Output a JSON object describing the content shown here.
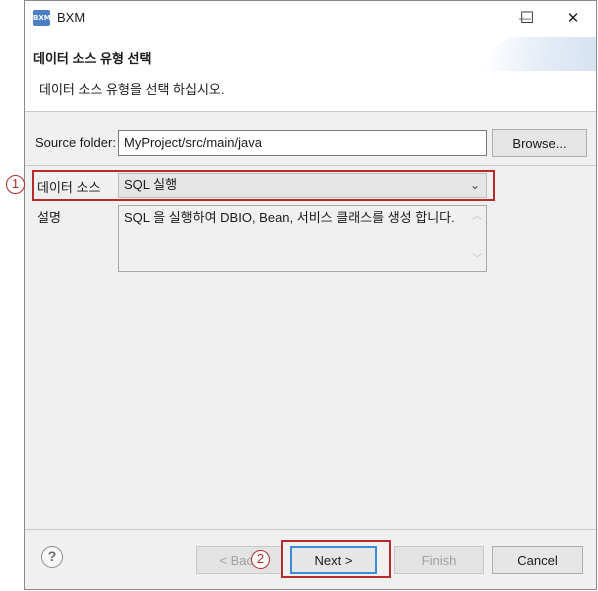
{
  "window": {
    "app_icon_text": "BXM",
    "title": "BXM",
    "minimize_glyph": "—",
    "maximize_glyph": "☐",
    "close_glyph": "✕"
  },
  "header": {
    "title": "데이터 소스 유형 선택",
    "subtitle": "데이터 소스 유형을 선택 하십시오."
  },
  "source_folder": {
    "label": "Source folder:",
    "value": "MyProject/src/main/java",
    "browse_label": "Browse..."
  },
  "data_source": {
    "label": "데이터 소스",
    "selected": "SQL 실행",
    "arrow_glyph": "⌄"
  },
  "description": {
    "label": "설명",
    "text": "SQL 을 실행하여 DBIO, Bean, 서비스 클래스를 생성 합니다.",
    "scroll_up_glyph": "︿",
    "scroll_down_glyph": "﹀"
  },
  "footer": {
    "help_glyph": "?",
    "back_label": "< Back",
    "next_label": "Next >",
    "finish_label": "Finish",
    "cancel_label": "Cancel"
  },
  "callouts": {
    "one": "1",
    "two": "2",
    "color": "#b52a2a"
  },
  "colors": {
    "default_button_border": "#3c8ad8",
    "app_icon_bg": "#4a7fc8"
  }
}
